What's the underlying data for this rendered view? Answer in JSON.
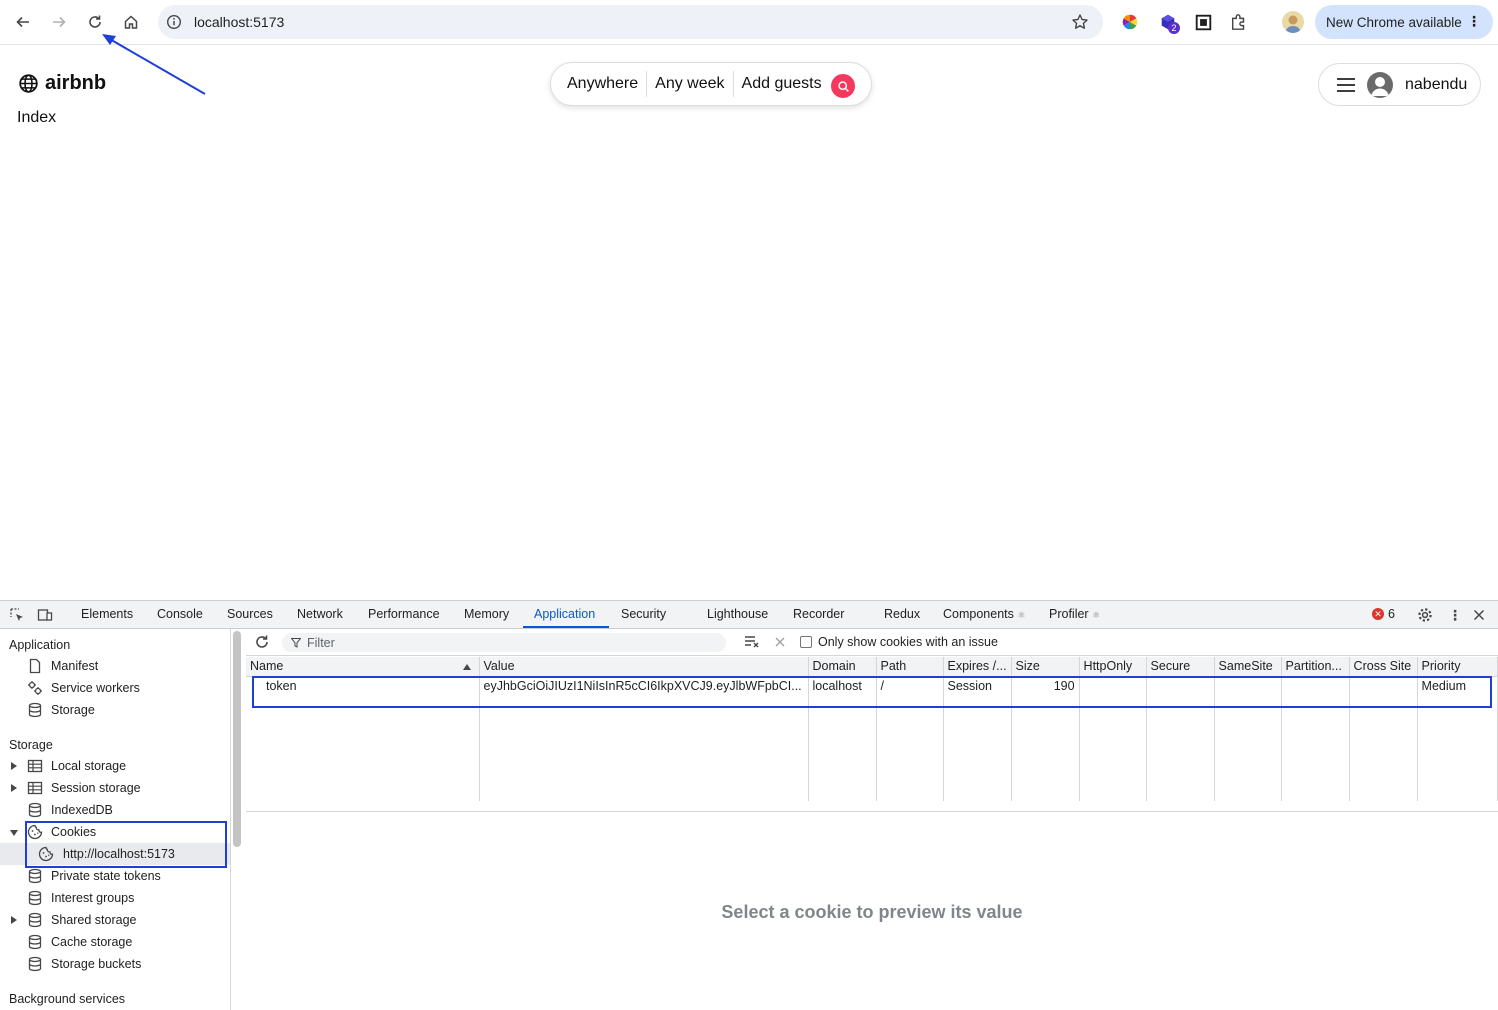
{
  "browser": {
    "url": "localhost:5173",
    "update_label": "New Chrome available",
    "extension_badge": "2"
  },
  "page": {
    "logo_text": "airbnb",
    "heading": "Index",
    "search": {
      "where": "Anywhere",
      "when": "Any week",
      "who": "Add guests"
    },
    "user_name": "nabendu"
  },
  "devtools": {
    "tabs": [
      "Elements",
      "Console",
      "Sources",
      "Network",
      "Performance",
      "Memory",
      "Application",
      "Security",
      "Lighthouse",
      "Recorder",
      "Redux",
      "Components",
      "Profiler"
    ],
    "active_tab": "Application",
    "error_count": "6",
    "sidebar": {
      "application_heading": "Application",
      "application_items": [
        "Manifest",
        "Service workers",
        "Storage"
      ],
      "storage_heading": "Storage",
      "storage_items": [
        "Local storage",
        "Session storage",
        "IndexedDB",
        "Cookies",
        "http://localhost:5173",
        "Private state tokens",
        "Interest groups",
        "Shared storage",
        "Cache storage",
        "Storage buckets"
      ],
      "background_heading": "Background services"
    },
    "filter_placeholder": "Filter",
    "only_issues_label": "Only show cookies with an issue",
    "columns": [
      "Name",
      "Value",
      "Domain",
      "Path",
      "Expires /...",
      "Size",
      "HttpOnly",
      "Secure",
      "SameSite",
      "Partition...",
      "Cross Site",
      "Priority"
    ],
    "rows": [
      [
        "token",
        "eyJhbGciOiJIUzI1NiIsInR5cCI6IkpXVCJ9.eyJlbWFpbCI...",
        "localhost",
        "/",
        "Session",
        "190",
        "",
        "",
        "",
        "",
        "",
        "Medium"
      ]
    ],
    "preview_message": "Select a cookie to preview its value"
  },
  "colors": {
    "brand": "#f5385d",
    "annotation": "#1f3fd6",
    "active_tab": "#0b57d0"
  }
}
